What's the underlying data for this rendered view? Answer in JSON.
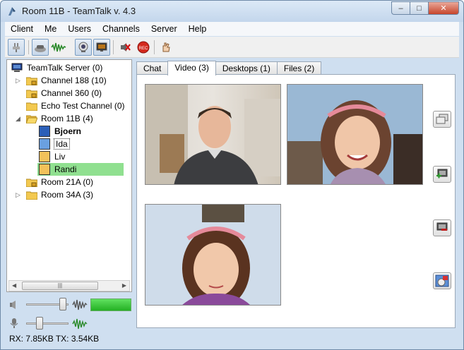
{
  "window": {
    "title": "Room 11B - TeamTalk v. 4.3"
  },
  "menu": [
    "Client",
    "Me",
    "Users",
    "Channels",
    "Server",
    "Help"
  ],
  "toolbar": {
    "icons": [
      "plug-icon",
      "headset-icon",
      "voice-activation-icon",
      "webcam-icon",
      "desktop-share-icon",
      "mute-all-icon",
      "record-icon",
      "hand-icon"
    ]
  },
  "tree": {
    "server": "TeamTalk Server (0)",
    "channels": [
      {
        "label": "Channel 188 (10)",
        "expandable": true
      },
      {
        "label": "Channel 360 (0)",
        "expandable": false
      },
      {
        "label": "Echo Test Channel (0)",
        "expandable": false
      },
      {
        "label": "Room 11B (4)",
        "expandable": true,
        "expanded": true
      },
      {
        "label": "Room 21A (0)",
        "expandable": false
      },
      {
        "label": "Room 34A (3)",
        "expandable": true
      }
    ],
    "users": [
      "Bjoern",
      "Ida",
      "Liv",
      "Randi"
    ]
  },
  "tabs": [
    "Chat",
    "Video (3)",
    "Desktops (1)",
    "Files (2)"
  ],
  "active_tab": "Video (3)",
  "status": {
    "text": "RX: 7.85KB TX: 3.54KB"
  },
  "colors": {
    "selected_user": "#90e090",
    "meter": "#3cc83c"
  }
}
